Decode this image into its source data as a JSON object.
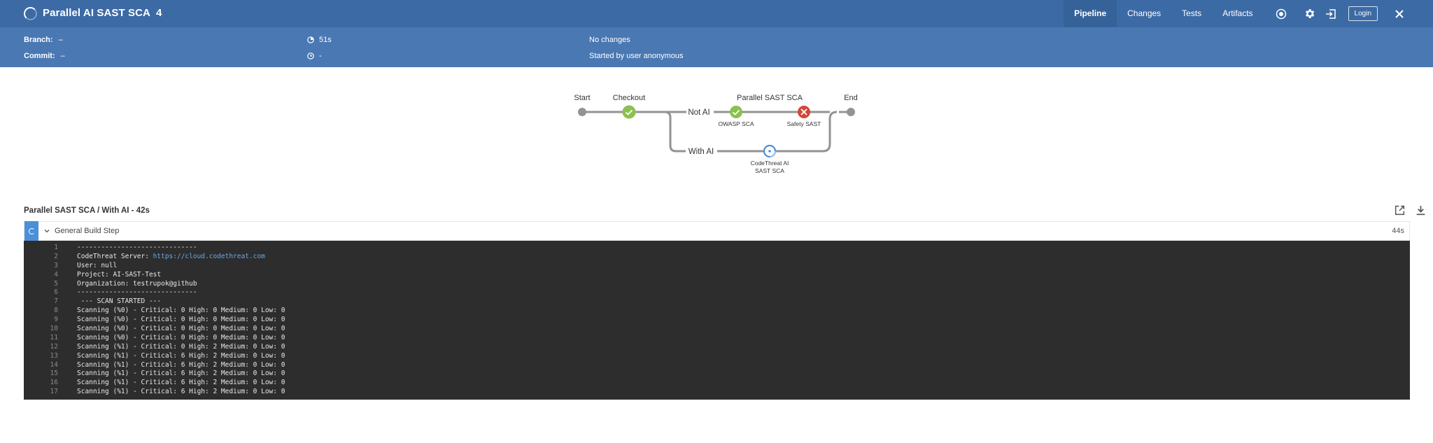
{
  "header": {
    "title": "Parallel AI SAST SCA",
    "run_number": "4",
    "tabs": [
      {
        "label": "Pipeline",
        "active": true
      },
      {
        "label": "Changes",
        "active": false
      },
      {
        "label": "Tests",
        "active": false
      },
      {
        "label": "Artifacts",
        "active": false
      }
    ],
    "login_label": "Login",
    "colors": {
      "bar": "#3c6aa5",
      "info_bar": "#4a78b3"
    }
  },
  "info": {
    "branch_label": "Branch:",
    "branch_value": "–",
    "commit_label": "Commit:",
    "commit_value": "–",
    "duration": "51s",
    "time": "-",
    "changes": "No changes",
    "started_by": "Started by user anonymous"
  },
  "pipeline": {
    "stages": {
      "start": "Start",
      "checkout": "Checkout",
      "parallel": "Parallel SAST SCA",
      "end": "End"
    },
    "branches": {
      "not_ai": "Not AI",
      "with_ai": "With AI"
    },
    "steps": {
      "owasp": "OWASP SCA",
      "safety": "Safety SAST",
      "codethreat_line1": "CodeThreat AI",
      "codethreat_line2": "SAST SCA"
    },
    "status_colors": {
      "success": "#8cc04f",
      "failure": "#d24939",
      "running": "#4a90d9",
      "node": "#949393"
    }
  },
  "log": {
    "title": "Parallel SAST SCA / With AI - 42s",
    "step_label": "General Build Step",
    "step_duration": "44s",
    "lines": [
      {
        "n": "1",
        "text": "------------------------------"
      },
      {
        "n": "2",
        "text": "CodeThreat Server: ",
        "link": "https://cloud.codethreat.com"
      },
      {
        "n": "3",
        "text": "User: null"
      },
      {
        "n": "4",
        "text": "Project: AI-SAST-Test"
      },
      {
        "n": "5",
        "text": "Organization: testrupok@github"
      },
      {
        "n": "6",
        "text": "------------------------------"
      },
      {
        "n": "7",
        "text": " --- SCAN STARTED ---"
      },
      {
        "n": "8",
        "text": "Scanning (%0) - Critical: 0 High: 0 Medium: 0 Low: 0"
      },
      {
        "n": "9",
        "text": "Scanning (%0) - Critical: 0 High: 0 Medium: 0 Low: 0"
      },
      {
        "n": "10",
        "text": "Scanning (%0) - Critical: 0 High: 0 Medium: 0 Low: 0"
      },
      {
        "n": "11",
        "text": "Scanning (%0) - Critical: 0 High: 0 Medium: 0 Low: 0"
      },
      {
        "n": "12",
        "text": "Scanning (%1) - Critical: 0 High: 2 Medium: 0 Low: 0"
      },
      {
        "n": "13",
        "text": "Scanning (%1) - Critical: 6 High: 2 Medium: 0 Low: 0"
      },
      {
        "n": "14",
        "text": "Scanning (%1) - Critical: 6 High: 2 Medium: 0 Low: 0"
      },
      {
        "n": "15",
        "text": "Scanning (%1) - Critical: 6 High: 2 Medium: 0 Low: 0"
      },
      {
        "n": "16",
        "text": "Scanning (%1) - Critical: 6 High: 2 Medium: 0 Low: 0"
      },
      {
        "n": "17",
        "text": "Scanning (%1) - Critical: 6 High: 2 Medium: 0 Low: 0"
      }
    ]
  }
}
